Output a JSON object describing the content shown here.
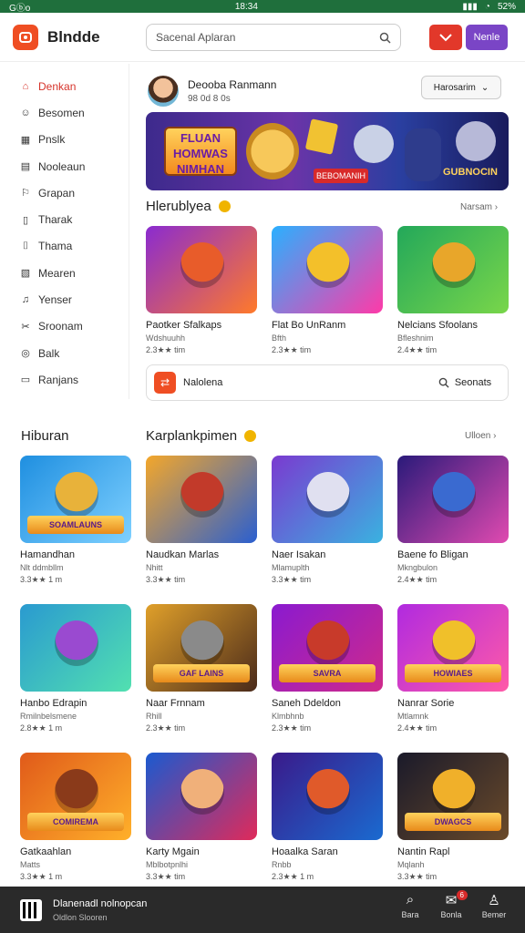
{
  "status": {
    "left": "Gⓑo",
    "time": "18:34",
    "battery": "52%"
  },
  "header": {
    "brand": "Blndde",
    "search_placeholder": "Sacenal Aplaran",
    "btn2_label": "Nenle"
  },
  "sidebar": {
    "items": [
      {
        "label": "Denkan",
        "icon": "home-icon",
        "active": true
      },
      {
        "label": "Besomen",
        "icon": "user-icon"
      },
      {
        "label": "Pnslk",
        "icon": "grid-icon"
      },
      {
        "label": "Nooleaun",
        "icon": "doc-icon"
      },
      {
        "label": "Grapan",
        "icon": "bookmark-icon"
      },
      {
        "label": "Tharak",
        "icon": "book-icon"
      },
      {
        "label": "Thama",
        "icon": "tag-icon"
      },
      {
        "label": "Mearen",
        "icon": "chart-icon"
      },
      {
        "label": "Yenser",
        "icon": "bell-icon"
      },
      {
        "label": "Sroonam",
        "icon": "tools-icon"
      },
      {
        "label": "Balk",
        "icon": "settings-icon"
      },
      {
        "label": "Ranjans",
        "icon": "flag-icon"
      }
    ]
  },
  "profile": {
    "name": "Deooba Ranmann",
    "sub": "98 0d 8 0s",
    "select_label": "Harosarim"
  },
  "banner": {
    "title": "FLUAN HOMWAS NIMHAN",
    "button": "BEBOMANIH",
    "right_label": "GUBNOCIN"
  },
  "section1": {
    "title": "Hlerublyea",
    "link": "Narsam"
  },
  "cards_top": [
    {
      "title": "Paotker Sfalkaps",
      "sub1": "Wdshuuhh",
      "sub2": "2.3★★ tim"
    },
    {
      "title": "Flat Bo UnRanm",
      "sub1": "Bfth",
      "sub2": "2.3★★ tim"
    },
    {
      "title": "Nelcians Sfoolans",
      "sub1": "Bfleshnim",
      "sub2": "2.4★★ tim"
    }
  ],
  "bar2": {
    "label": "Nalolena",
    "search": "Seonats"
  },
  "section2": {
    "left_title": "Hiburan",
    "title": "Karplankpimen",
    "link": "Ulloen"
  },
  "cards_grid": [
    {
      "title": "Hamandhan",
      "sub1": "Nlt ddmbllm",
      "sub2": "3.3★★ 1 m"
    },
    {
      "title": "Naudkan Marlas",
      "sub1": "Nhitt",
      "sub2": "3.3★★ tim"
    },
    {
      "title": "Naer Isakan",
      "sub1": "Mlamuplth",
      "sub2": "3.3★★ tim"
    },
    {
      "title": "Baene fo Bligan",
      "sub1": "Mkngbulon",
      "sub2": "2.4★★ tim"
    },
    {
      "title": "Hanbo Edrapin",
      "sub1": "Rmilnbelsmene",
      "sub2": "2.8★★ 1 m"
    },
    {
      "title": "Naar Frnnam",
      "sub1": "Rhill",
      "sub2": "2.3★★ tim"
    },
    {
      "title": "Saneh Ddeldon",
      "sub1": "Klmbhnb",
      "sub2": "2.3★★ tim"
    },
    {
      "title": "Nanrar Sorie",
      "sub1": "Mtlamnk",
      "sub2": "2.4★★ tim"
    },
    {
      "title": "Gatkaahlan",
      "sub1": "Matts",
      "sub2": "3.3★★ 1 m"
    },
    {
      "title": "Karty Mgain",
      "sub1": "Mblbotpnlhi",
      "sub2": "3.3★★ tim"
    },
    {
      "title": "Hoaalka Saran",
      "sub1": "Rnbb",
      "sub2": "2.3★★ 1 m"
    },
    {
      "title": "Nantin Rapl",
      "sub1": "Mqlanh",
      "sub2": "3.3★★ tim"
    }
  ],
  "thumb_tags": [
    "SOAMLAUNS",
    "",
    "",
    "",
    "",
    "GAF LAINS",
    "SAVRA",
    "HOWIAES",
    "COMIREMA",
    "",
    "",
    "DWAGCS"
  ],
  "bottom": {
    "title": "Dlanenadl nolnopcan",
    "sub": "Oldlon Slooren",
    "nav": [
      {
        "icon": "search-icon",
        "label": "Bara"
      },
      {
        "icon": "message-icon",
        "label": "Bonla",
        "badge": "6"
      },
      {
        "icon": "person-icon",
        "label": "Bemer"
      }
    ]
  }
}
